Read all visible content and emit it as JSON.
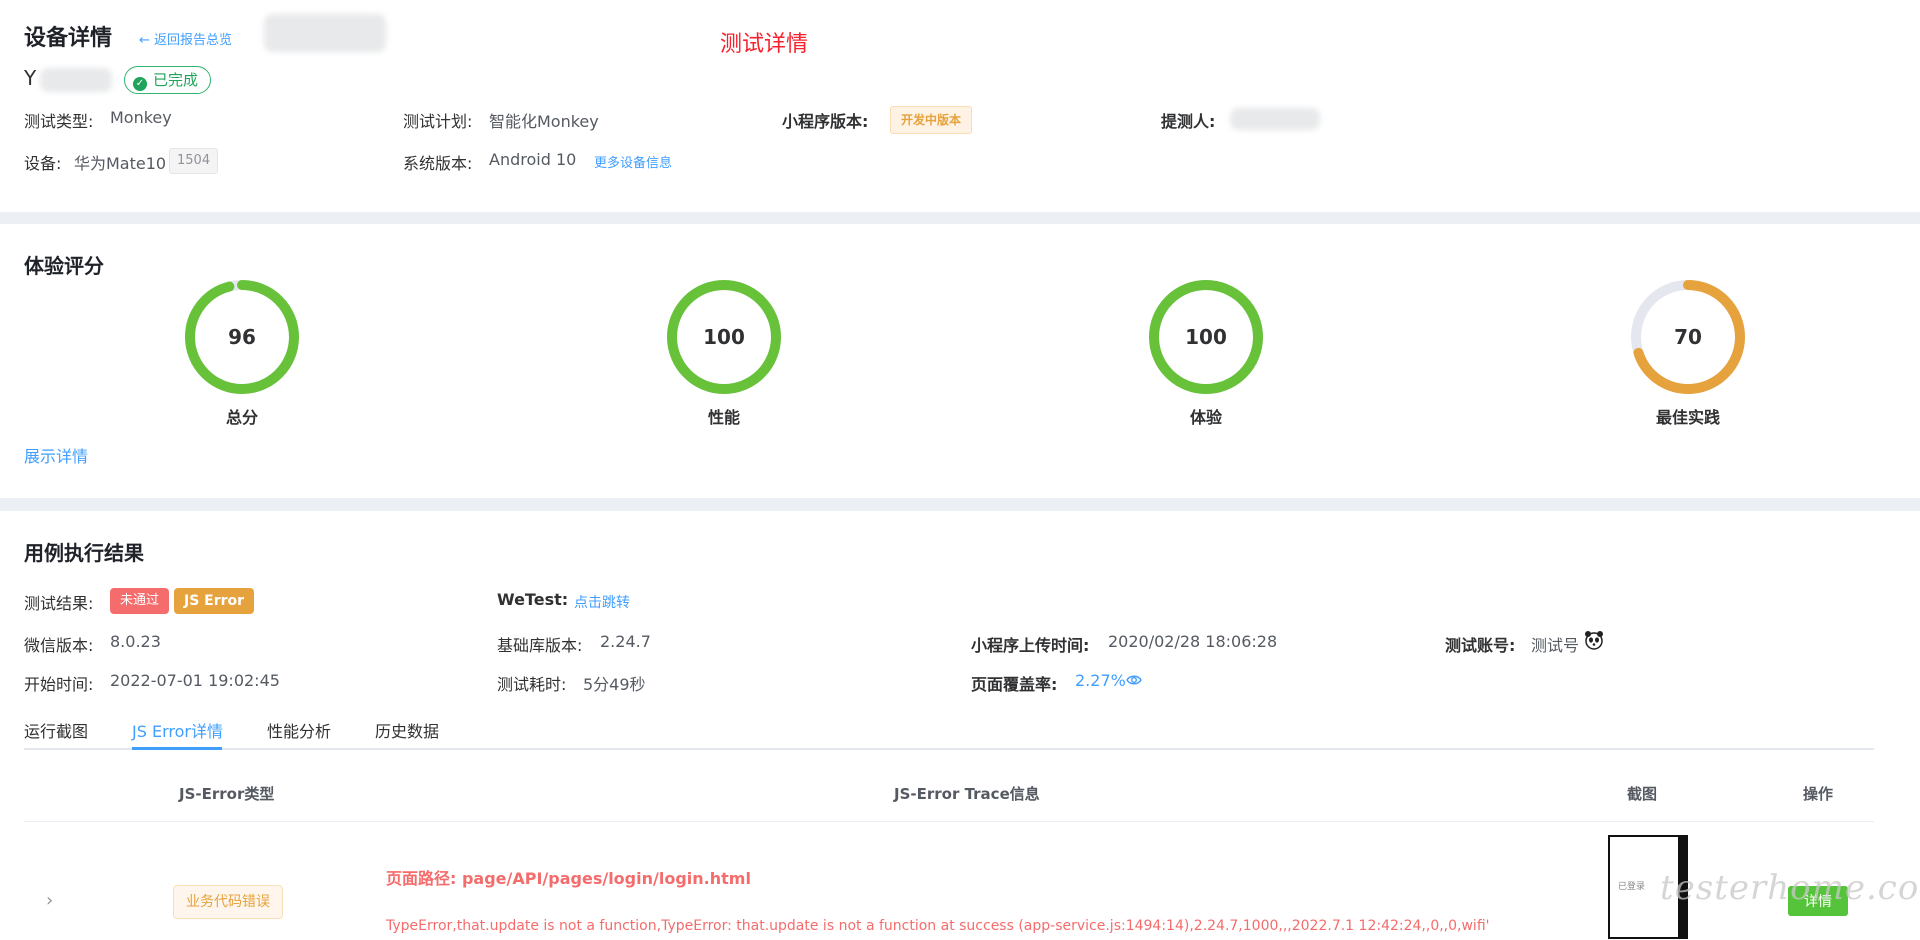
{
  "header": {
    "title": "设备详情",
    "back_link": "← 返回报告总览",
    "center_title": "测试详情",
    "device_name_prefix": "Y",
    "status_badge": "已完成"
  },
  "info": {
    "test_type_label": "测试类型:",
    "test_type_value": "Monkey",
    "test_plan_label": "测试计划:",
    "test_plan_value": "智能化Monkey",
    "mp_version_label": "小程序版本:",
    "mp_version_tag": "开发中版本",
    "submitter_label": "提测人:",
    "device_label": "设备:",
    "device_value": "华为Mate10",
    "device_tag": "1504",
    "os_label": "系统版本:",
    "os_value": "Android 10",
    "more_device_link": "更多设备信息"
  },
  "scores": {
    "section_title": "体验评分",
    "show_details": "展示详情",
    "items": [
      {
        "label": "总分",
        "value": 96,
        "color": "#67c23a"
      },
      {
        "label": "性能",
        "value": 100,
        "color": "#67c23a"
      },
      {
        "label": "体验",
        "value": 100,
        "color": "#67c23a"
      },
      {
        "label": "最佳实践",
        "value": 70,
        "color": "#e6a23c"
      }
    ],
    "track_color": "#e4e7ed"
  },
  "results": {
    "section_title": "用例执行结果",
    "result_label": "测试结果:",
    "result_tags": [
      "未通过",
      "JS Error"
    ],
    "wetest_label": "WeTest:",
    "wetest_link": "点击跳转",
    "wechat_label": "微信版本:",
    "wechat_value": "8.0.23",
    "lib_label": "基础库版本:",
    "lib_value": "2.24.7",
    "upload_label": "小程序上传时间:",
    "upload_value": "2020/02/28 18:06:28",
    "account_label": "测试账号:",
    "account_value": "测试号",
    "start_label": "开始时间:",
    "start_value": "2022-07-01 19:02:45",
    "duration_label": "测试耗时:",
    "duration_value": "5分49秒",
    "coverage_label": "页面覆盖率:",
    "coverage_value": "2.27%"
  },
  "tabs": [
    "运行截图",
    "JS Error详情",
    "性能分析",
    "历史数据"
  ],
  "active_tab": 1,
  "table": {
    "headers": [
      "JS-Error类型",
      "JS-Error Trace信息",
      "截图",
      "操作"
    ],
    "rows": [
      {
        "type": "业务代码错误",
        "path": "页面路径: page/API/pages/login/login.html",
        "trace": "TypeError,that.update is not a function,TypeError: that.update is not a function at success (app-service.js:1494:14),2.24.7,1000,,,2022.7.1 12:42:24,,0,,0,wifi'",
        "screenshot_text": "已登录",
        "action": "详情"
      }
    ]
  },
  "watermark": "testerhome.com",
  "colors": {
    "accent": "#409eff",
    "error": "#f56c6c",
    "success": "#20a35a",
    "warning": "#e6a23c"
  }
}
